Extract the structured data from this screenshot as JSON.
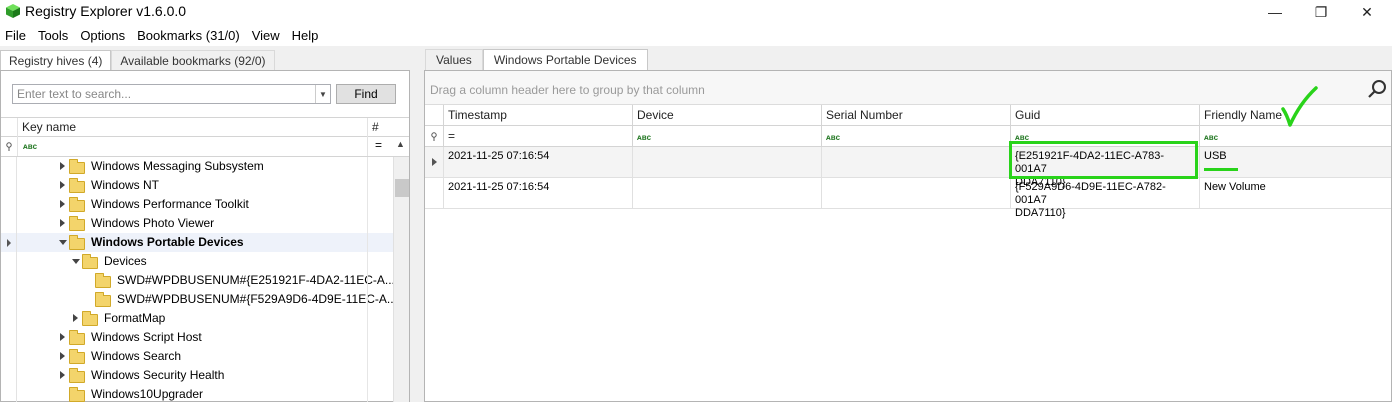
{
  "window": {
    "title": "Registry Explorer v1.6.0.0",
    "minimize": "—",
    "maximize": "❐",
    "close": "✕"
  },
  "menu": [
    "File",
    "Tools",
    "Options",
    "Bookmarks (31/0)",
    "View",
    "Help"
  ],
  "left": {
    "tabs": [
      "Registry hives (4)",
      "Available bookmarks (92/0)"
    ],
    "search_placeholder": "Enter text to search...",
    "find_label": "Find",
    "col_key_name": "Key name",
    "col_values": "# values",
    "filter_abc": "ᴀʙc",
    "filter_eq": "=",
    "tree": [
      {
        "label": "Windows Messaging Subsystem",
        "indent": 1,
        "expander": "right",
        "selected": false
      },
      {
        "label": "Windows NT",
        "indent": 1,
        "expander": "right",
        "selected": false
      },
      {
        "label": "Windows Performance Toolkit",
        "indent": 1,
        "expander": "right",
        "selected": false
      },
      {
        "label": "Windows Photo Viewer",
        "indent": 1,
        "expander": "right",
        "selected": false
      },
      {
        "label": "Windows Portable Devices",
        "indent": 1,
        "expander": "down",
        "selected": true
      },
      {
        "label": "Devices",
        "indent": 2,
        "expander": "down",
        "selected": false
      },
      {
        "label": "SWD#WPDBUSENUM#{E251921F-4DA2-11EC-A...",
        "indent": 3,
        "expander": "none",
        "selected": false
      },
      {
        "label": "SWD#WPDBUSENUM#{F529A9D6-4D9E-11EC-A...",
        "indent": 3,
        "expander": "none",
        "selected": false
      },
      {
        "label": "FormatMap",
        "indent": 2,
        "expander": "right",
        "selected": false
      },
      {
        "label": "Windows Script Host",
        "indent": 1,
        "expander": "right",
        "selected": false
      },
      {
        "label": "Windows Search",
        "indent": 1,
        "expander": "right",
        "selected": false
      },
      {
        "label": "Windows Security Health",
        "indent": 1,
        "expander": "right",
        "selected": false
      },
      {
        "label": "Windows10Upgrader",
        "indent": 1,
        "expander": "none",
        "selected": false
      }
    ]
  },
  "right": {
    "tabs": [
      "Values",
      "Windows Portable Devices"
    ],
    "group_hint": "Drag a column header here to group by that column",
    "columns": [
      "Timestamp",
      "Device",
      "Serial Number",
      "Guid",
      "Friendly Name"
    ],
    "rows": [
      {
        "timestamp": "2021-11-25 07:16:54",
        "device": "",
        "serial": "",
        "guid": "{E251921F-4DA2-11EC-A783-001A7\nDDA7110}",
        "friendly": "USB"
      },
      {
        "timestamp": "2021-11-25 07:16:54",
        "device": "",
        "serial": "",
        "guid": "{F529A9D6-4D9E-11EC-A782-001A7\nDDA7110}",
        "friendly": "New Volume"
      }
    ]
  },
  "colors": {
    "annotation_green": "#29d31a",
    "folder_yellow": "#f3d46b"
  }
}
